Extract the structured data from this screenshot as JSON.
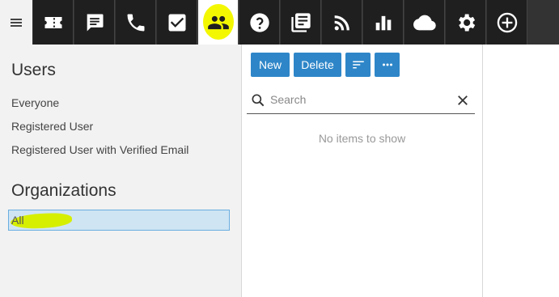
{
  "toolbar": {
    "menu_icon": "hamburger-menu-icon",
    "buttons": [
      {
        "icon": "ticket-icon"
      },
      {
        "icon": "chat-icon"
      },
      {
        "icon": "phone-icon"
      },
      {
        "icon": "checkbox-icon"
      },
      {
        "icon": "users-icon",
        "active": true
      },
      {
        "icon": "help-icon"
      },
      {
        "icon": "knowledge-base-icon"
      },
      {
        "icon": "rss-feed-icon"
      },
      {
        "icon": "reports-chart-icon"
      },
      {
        "icon": "cloud-icon"
      },
      {
        "icon": "settings-gear-icon"
      },
      {
        "icon": "add-circle-icon"
      }
    ],
    "colors": {
      "bar": "#333333",
      "button": "#1f1f1f",
      "highlight": "#f3f800"
    }
  },
  "users": {
    "title": "Users",
    "items": [
      "Everyone",
      "Registered User",
      "Registered User with Verified Email"
    ]
  },
  "organizations": {
    "title": "Organizations",
    "items": [
      {
        "label": "All",
        "selected": true
      }
    ]
  },
  "list": {
    "new_label": "New",
    "delete_label": "Delete",
    "sort_icon": "sort-icon",
    "more_icon": "more-options-icon",
    "search_placeholder": "Search",
    "empty_text": "No items to show",
    "accent": "#2e86c8"
  }
}
